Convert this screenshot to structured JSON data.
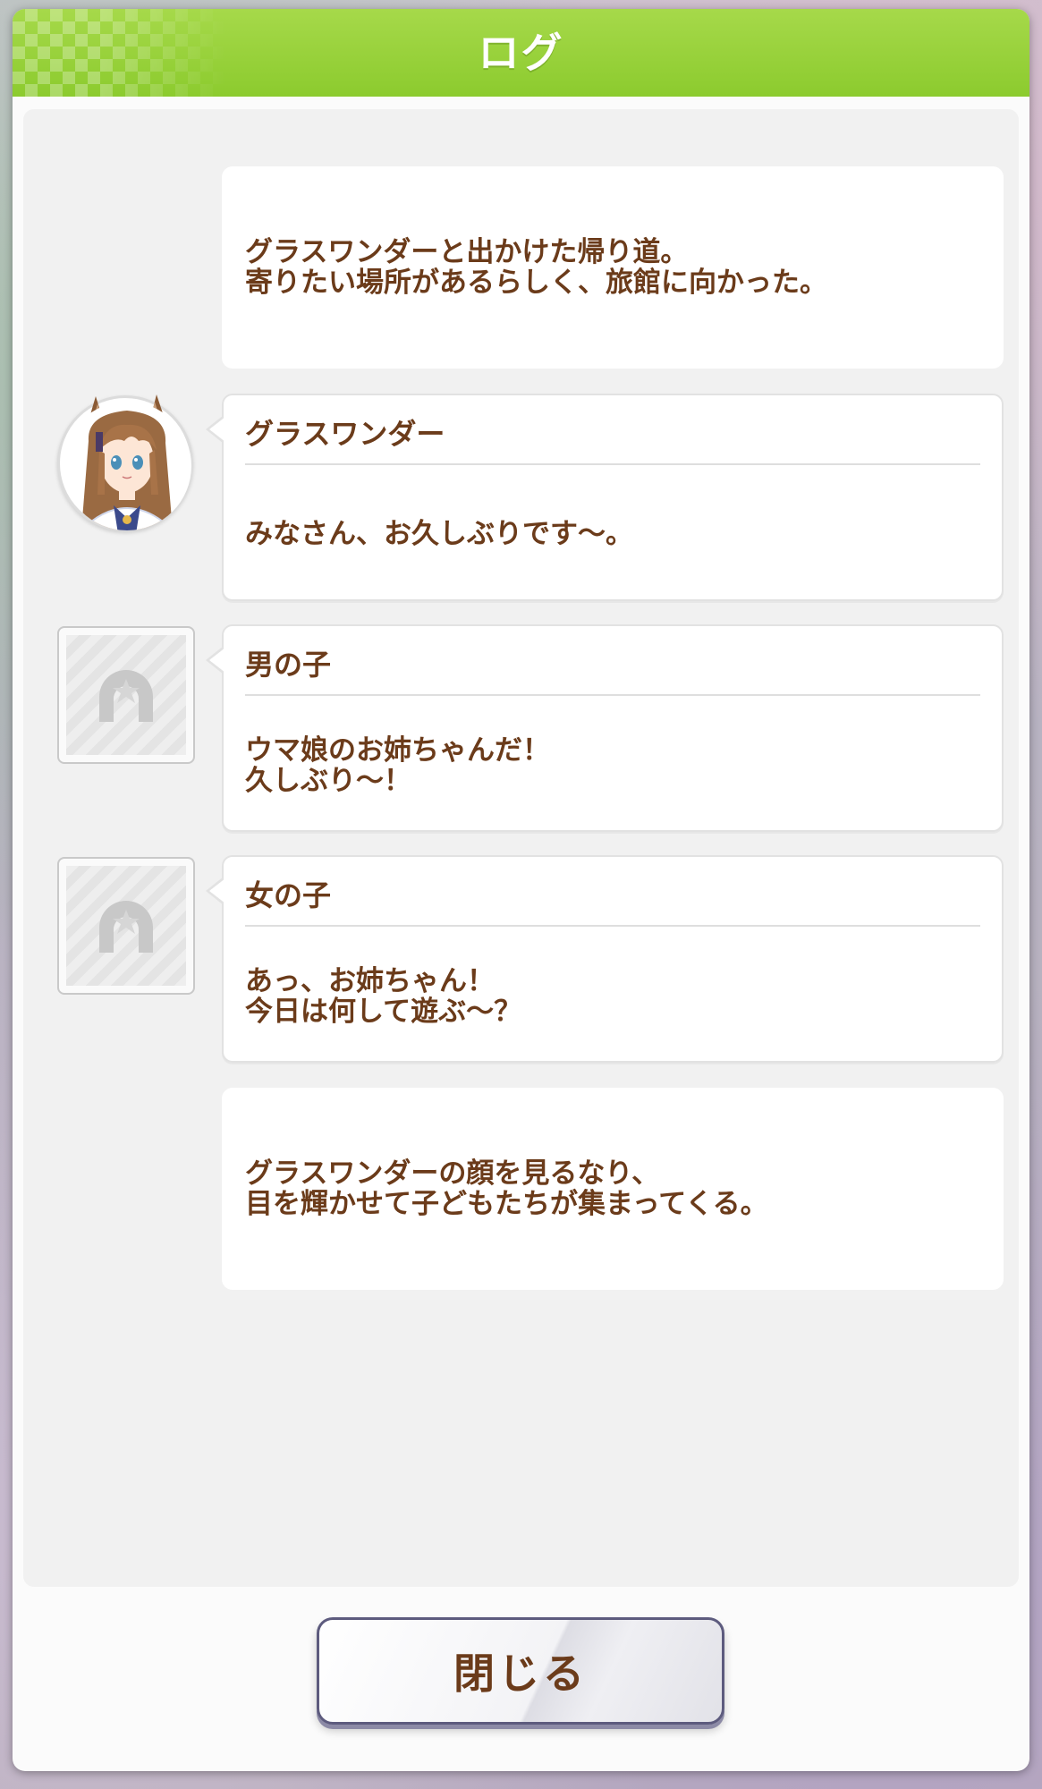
{
  "header": {
    "title": "ログ"
  },
  "log": {
    "entries": [
      {
        "type": "narration",
        "text": "グラスワンダーと出かけた帰り道。\n寄りたい場所があるらしく、旅館に向かった。"
      },
      {
        "type": "dialogue",
        "speaker": "グラスワンダー",
        "avatar": "character-portrait",
        "text": "みなさん、お久しぶりです～。"
      },
      {
        "type": "dialogue",
        "speaker": "男の子",
        "avatar": "horseshoe-placeholder-icon",
        "text": "ウマ娘のお姉ちゃんだ！\n久しぶり～！"
      },
      {
        "type": "dialogue",
        "speaker": "女の子",
        "avatar": "horseshoe-placeholder-icon",
        "text": "あっ、お姉ちゃん！\n今日は何して遊ぶ～？"
      },
      {
        "type": "narration",
        "text": "グラスワンダーの顔を見るなり、\n目を輝かせて子どもたちが集まってくる。"
      }
    ]
  },
  "footer": {
    "close_label": "閉じる"
  },
  "colors": {
    "header_green": "#8ccb2e",
    "text_brown": "#6b3b1a",
    "button_border": "#5d5b7e"
  }
}
